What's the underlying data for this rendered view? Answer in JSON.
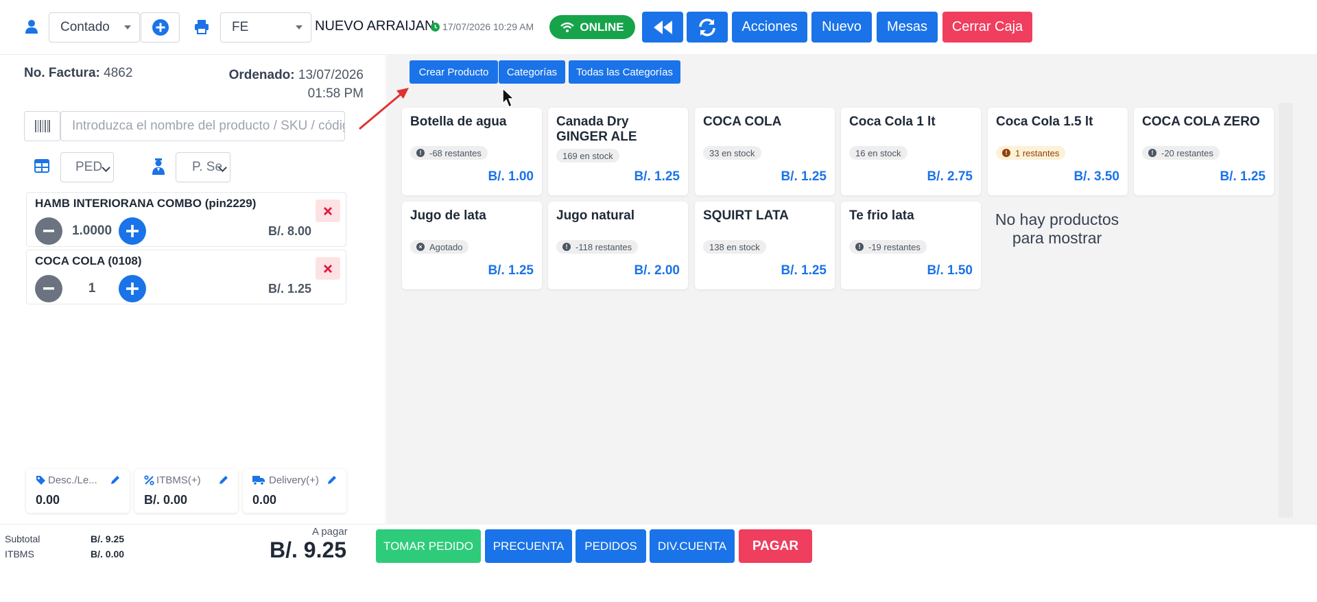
{
  "topbar": {
    "customer_select": "Contado",
    "document_select": "FE",
    "branch_name": "NUEVO ARRAIJAN",
    "datetime": "17/07/2026 10:29 AM",
    "status": "ONLINE",
    "actions_label": "Acciones",
    "new_label": "Nuevo",
    "tables_label": "Mesas",
    "close_register_label": "Cerrar Caja"
  },
  "order": {
    "invoice_label": "No. Factura:",
    "invoice_number": "4862",
    "ordered_label": "Ordenado:",
    "ordered_date": "13/07/2026 01:58 PM",
    "search_placeholder": "Introduzca el nombre del producto / SKU / código de barras",
    "order_type": "PED",
    "seller": "P. Se",
    "items": [
      {
        "name": "HAMB INTERIORANA COMBO (pin2229)",
        "qty": "1.0000",
        "price": "B/. 8.00"
      },
      {
        "name": "COCA COLA (0108)",
        "qty": "1",
        "price": "B/. 1.25"
      }
    ],
    "adjustments": [
      {
        "label": "Desc./Le...",
        "value": "0.00",
        "icon": "tag-icon"
      },
      {
        "label": "ITBMS(+)",
        "value": "B/. 0.00",
        "icon": "percent-icon"
      },
      {
        "label": "Delivery(+)",
        "value": "0.00",
        "icon": "truck-icon"
      }
    ]
  },
  "catalog": {
    "create_product": "Crear Producto",
    "categories": "Categorías",
    "all_categories": "Todas las Categorías",
    "empty_message": "No hay productos para mostrar",
    "products": [
      {
        "name": "Botella de agua",
        "stock": "-68 restantes",
        "price": "B/. 1.00",
        "badge": "info"
      },
      {
        "name": "Canada Dry GINGER ALE",
        "stock": "169 en stock",
        "price": "B/. 1.25",
        "badge": "plain"
      },
      {
        "name": "COCA COLA",
        "stock": "33 en stock",
        "price": "B/. 1.25",
        "badge": "plain"
      },
      {
        "name": "Coca Cola 1 lt",
        "stock": "16 en stock",
        "price": "B/. 2.75",
        "badge": "plain"
      },
      {
        "name": "Coca Cola 1.5 lt",
        "stock": "1 restantes",
        "price": "B/. 3.50",
        "badge": "warn"
      },
      {
        "name": "COCA COLA ZERO",
        "stock": "-20 restantes",
        "price": "B/. 1.25",
        "badge": "info"
      },
      {
        "name": "Jugo de lata",
        "stock": "Agotado",
        "price": "B/. 1.25",
        "badge": "x"
      },
      {
        "name": "Jugo natural",
        "stock": "-118 restantes",
        "price": "B/. 2.00",
        "badge": "info"
      },
      {
        "name": "SQUIRT LATA",
        "stock": "138 en stock",
        "price": "B/. 1.25",
        "badge": "plain"
      },
      {
        "name": "Te frio lata",
        "stock": "-19 restantes",
        "price": "B/. 1.50",
        "badge": "info"
      }
    ]
  },
  "footer": {
    "subtotal_label": "Subtotal",
    "subtotal_value": "B/. 9.25",
    "itbms_label": "ITBMS",
    "itbms_value": "B/. 0.00",
    "to_pay_label": "A pagar",
    "to_pay_value": "B/. 9.25",
    "take_order": "TOMAR PEDIDO",
    "pre_bill": "PRECUENTA",
    "orders": "PEDIDOS",
    "split_bill": "DIV.CUENTA",
    "pay": "PAGAR"
  },
  "colors": {
    "primary": "#1a73e8",
    "danger": "#f03e5e",
    "success": "#16a34a",
    "take_order_green": "#2ecc7a",
    "warning_badge": "#fdf1d6"
  }
}
